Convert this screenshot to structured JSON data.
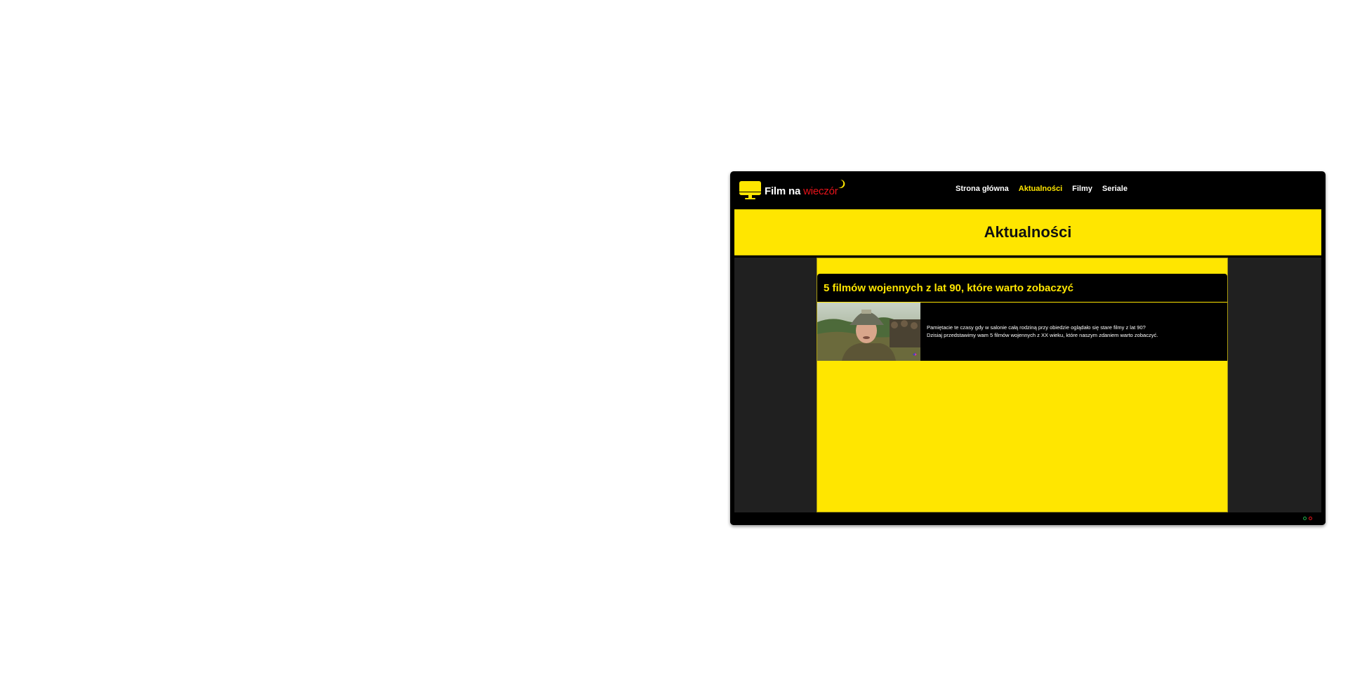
{
  "brand": {
    "name_main": "Film na",
    "name_accent": "wieczór",
    "colors": {
      "primary": "#ffe600",
      "accent": "#e8131a",
      "background": "#000000",
      "panel": "#202020"
    }
  },
  "nav": {
    "items": [
      {
        "label": "Strona główna",
        "active": false
      },
      {
        "label": "Aktualności",
        "active": true
      },
      {
        "label": "Filmy",
        "active": false
      },
      {
        "label": "Seriale",
        "active": false
      }
    ]
  },
  "hero": {
    "title": "Aktualności"
  },
  "articles": [
    {
      "title": "5 filmów wojennych z lat 90, które warto zobaczyć",
      "excerpt_line1": "Pamiętacie te czasy gdy w salonie całą rodziną przy obiedzie oglądało się stare filmy z lat 90?",
      "excerpt_line2": "Dzisiaj przedstawimy wam 5 filmów wojennych z XX wieku, które naszym zdaniem warto zobaczyć.",
      "thumbnail_icon": "soldier-helmet-photo"
    }
  ],
  "footer": {
    "indicators": [
      "green-circle-icon",
      "red-circle-icon"
    ]
  }
}
